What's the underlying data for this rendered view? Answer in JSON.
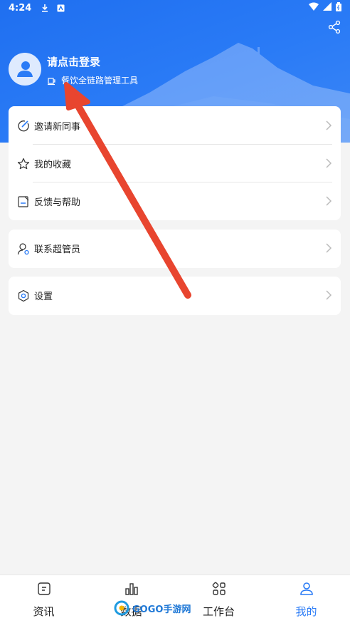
{
  "status_bar": {
    "time": "4:24",
    "icons": [
      "download-icon",
      "notification-app-icon",
      "wifi-icon",
      "signal-icon",
      "battery-icon"
    ]
  },
  "header": {
    "login_prompt": "请点击登录",
    "subtitle": "餐饮全链路管理工具",
    "share_icon": "share-icon",
    "background_color": "#2a7bf6"
  },
  "menu": {
    "group1": [
      {
        "label": "邀请新同事",
        "icon": "invite-icon"
      },
      {
        "label": "我的收藏",
        "icon": "star-icon"
      },
      {
        "label": "反馈与帮助",
        "icon": "feedback-icon"
      }
    ],
    "group2": [
      {
        "label": "联系超管员",
        "icon": "contact-admin-icon"
      }
    ],
    "group3": [
      {
        "label": "设置",
        "icon": "gear-icon"
      }
    ]
  },
  "tabbar": {
    "tabs": [
      {
        "label": "资讯",
        "icon": "news-icon",
        "active": false
      },
      {
        "label": "数据",
        "icon": "data-chart-icon",
        "active": false
      },
      {
        "label": "工作台",
        "icon": "workbench-icon",
        "active": false
      },
      {
        "label": "我的",
        "icon": "profile-icon",
        "active": true
      }
    ],
    "active_color": "#2a7bf6"
  },
  "annotation": {
    "arrow_color": "#e8452f"
  },
  "watermark": {
    "text": "GOGO手游网"
  }
}
